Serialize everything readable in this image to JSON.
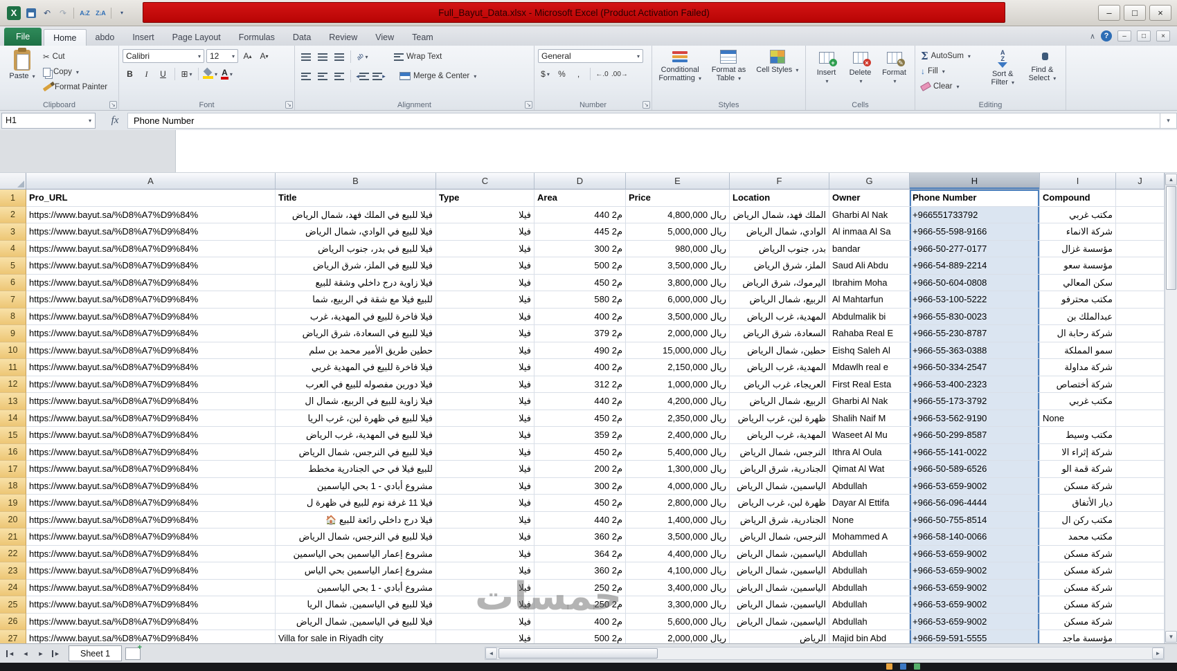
{
  "window": {
    "title": "Full_Bayut_Data.xlsx  -  Microsoft Excel (Product Activation Failed)",
    "accent_red": "#c00000"
  },
  "ribbon": {
    "tabs": [
      "File",
      "Home",
      "abdo",
      "Insert",
      "Page Layout",
      "Formulas",
      "Data",
      "Review",
      "View",
      "Team"
    ],
    "clipboard": {
      "label": "Clipboard",
      "paste": "Paste",
      "cut": "Cut",
      "copy": "Copy",
      "format_painter": "Format Painter"
    },
    "font": {
      "label": "Font",
      "family": "Calibri",
      "size": "12",
      "bold": "B",
      "italic": "I",
      "underline": "U"
    },
    "alignment": {
      "label": "Alignment",
      "wrap": "Wrap Text",
      "merge": "Merge & Center"
    },
    "number": {
      "label": "Number",
      "format": "General",
      "currency": "$",
      "percent": "%",
      "comma": ",",
      "inc_decimal": "←.0",
      "dec_decimal": ".00→"
    },
    "styles": {
      "label": "Styles",
      "conditional": "Conditional Formatting",
      "as_table": "Format as Table",
      "cell_styles": "Cell Styles"
    },
    "cells": {
      "label": "Cells",
      "insert": "Insert",
      "delete": "Delete",
      "format": "Format"
    },
    "editing": {
      "label": "Editing",
      "autosum": "AutoSum",
      "fill": "Fill",
      "clear": "Clear",
      "sort_filter": "Sort & Filter",
      "find_select": "Find & Select"
    }
  },
  "formula_bar": {
    "name_box": "H1",
    "function_label": "fx",
    "value": "Phone Number"
  },
  "grid": {
    "column_letters": [
      "A",
      "B",
      "C",
      "D",
      "E",
      "F",
      "G",
      "H",
      "I",
      "J"
    ],
    "selected_column": "H",
    "active_cell": "H1",
    "header_cells": [
      "Pro_URL",
      "Title",
      "Type",
      "Area",
      "Price",
      "Location",
      "Owner",
      "Phone Number",
      "Compound",
      ""
    ],
    "rows": [
      {
        "n": "2",
        "url": "https://www.bayut.sa/%D8%A7%D9%84%",
        "title": "فيلا للبيع في الملك فهد، شمال الرياض",
        "type": "فيلا",
        "area": "440 م2",
        "price": "4,800,000 ريال",
        "location": "الملك فهد، شمال الرياض",
        "owner": "Gharbi Al Nak",
        "phone": "+966551733792",
        "compound": "مكتب غربي"
      },
      {
        "n": "3",
        "url": "https://www.bayut.sa/%D8%A7%D9%84%",
        "title": "فيلا للبيع في الوادي، شمال الرياض",
        "type": "فيلا",
        "area": "445 م2",
        "price": "5,000,000 ريال",
        "location": "الوادي، شمال الرياض",
        "owner": "Al inmaa Al Sa",
        "phone": "+966-55-598-9166",
        "compound": "شركة الانماء"
      },
      {
        "n": "4",
        "url": "https://www.bayut.sa/%D8%A7%D9%84%",
        "title": "فيلا للبيع في بدر، جنوب الرياض",
        "type": "فيلا",
        "area": "300 م2",
        "price": "980,000 ريال",
        "location": "بدر، جنوب الرياض",
        "owner": "bandar",
        "phone": "+966-50-277-0177",
        "compound": "مؤسسة غزال"
      },
      {
        "n": "5",
        "url": "https://www.bayut.sa/%D8%A7%D9%84%",
        "title": "فيلا للبيع في الملز، شرق الرياض",
        "type": "فيلا",
        "area": "500 م2",
        "price": "3,500,000 ريال",
        "location": "الملز، شرق الرياض",
        "owner": "Saud Ali Abdu",
        "phone": "+966-54-889-2214",
        "compound": "مؤسسة سعو"
      },
      {
        "n": "6",
        "url": "https://www.bayut.sa/%D8%A7%D9%84%",
        "title": "فيلا زاوية درج داخلي وشقة للبيع",
        "type": "فيلا",
        "area": "450 م2",
        "price": "3,800,000 ريال",
        "location": "اليرموك، شرق الرياض",
        "owner": "Ibrahim Moha",
        "phone": "+966-50-604-0808",
        "compound": "سكن المعالي"
      },
      {
        "n": "7",
        "url": "https://www.bayut.sa/%D8%A7%D9%84%",
        "title": "للبيع فيلا مع شقة في الربيع، شما",
        "type": "فيلا",
        "area": "580 م2",
        "price": "6,000,000 ريال",
        "location": "الربيع، شمال الرياض",
        "owner": "Al Mahtarfun",
        "phone": "+966-53-100-5222",
        "compound": "مكتب محترفو"
      },
      {
        "n": "8",
        "url": "https://www.bayut.sa/%D8%A7%D9%84%",
        "title": "فيلا فاخرة للبيع في المهدية، غرب",
        "type": "فيلا",
        "area": "400 م2",
        "price": "3,500,000 ريال",
        "location": "المهدية، غرب الرياض",
        "owner": "Abdulmalik bi",
        "phone": "+966-55-830-0023",
        "compound": "عبدالملك بن"
      },
      {
        "n": "9",
        "url": "https://www.bayut.sa/%D8%A7%D9%84%",
        "title": "فيلا للبيع في السعادة، شرق الرياض",
        "type": "فيلا",
        "area": "379 م2",
        "price": "2,000,000 ريال",
        "location": "السعادة، شرق الرياض",
        "owner": "Rahaba Real E",
        "phone": "+966-55-230-8787",
        "compound": "شركة رحابة ال"
      },
      {
        "n": "10",
        "url": "https://www.bayut.sa/%D8%A7%D9%84%",
        "title": "حطين طريق الأمير محمد بن سلم",
        "type": "فيلا",
        "area": "490 م2",
        "price": "15,000,000 ريال",
        "location": "حطين، شمال الرياض",
        "owner": "Eishq Saleh Al",
        "phone": "+966-55-363-0388",
        "compound": "سمو المملكة"
      },
      {
        "n": "11",
        "url": "https://www.bayut.sa/%D8%A7%D9%84%",
        "title": "فيلا فاخرة للبيع في المهدية غربي",
        "type": "فيلا",
        "area": "400 م2",
        "price": "2,150,000 ريال",
        "location": "المهدية، غرب الرياض",
        "owner": "Mdawlh real e",
        "phone": "+966-50-334-2547",
        "compound": "شركة مداولة"
      },
      {
        "n": "12",
        "url": "https://www.bayut.sa/%D8%A7%D9%84%",
        "title": "فيلا دورين مفصوله للبيع في العرب",
        "type": "فيلا",
        "area": "312 م2",
        "price": "1,000,000 ريال",
        "location": "العريجاء، غرب الرياض",
        "owner": "First Real Esta",
        "phone": "+966-53-400-2323",
        "compound": "شركة أختصاص"
      },
      {
        "n": "13",
        "url": "https://www.bayut.sa/%D8%A7%D9%84%",
        "title": "فيلا زاوية للبيع في الربيع، شمال ال",
        "type": "فيلا",
        "area": "440 م2",
        "price": "4,200,000 ريال",
        "location": "الربيع، شمال الرياض",
        "owner": "Gharbi Al Nak",
        "phone": "+966-55-173-3792",
        "compound": "مكتب غربي"
      },
      {
        "n": "14",
        "url": "https://www.bayut.sa/%D8%A7%D9%84%",
        "title": "فيلا للبيع في ظهرة لبن، غرب الريا",
        "type": "فيلا",
        "area": "450 م2",
        "price": "2,350,000 ريال",
        "location": "ظهرة لبن، غرب الرياض",
        "owner": "Shalih Naif M",
        "phone": "+966-53-562-9190",
        "compound": "None"
      },
      {
        "n": "15",
        "url": "https://www.bayut.sa/%D8%A7%D9%84%",
        "title": "فيلا للبيع في المهدية، غرب الرياض",
        "type": "فيلا",
        "area": "359 م2",
        "price": "2,400,000 ريال",
        "location": "المهدية، غرب الرياض",
        "owner": "Waseet Al Mu",
        "phone": "+966-50-299-8587",
        "compound": "مكتب وسيط"
      },
      {
        "n": "16",
        "url": "https://www.bayut.sa/%D8%A7%D9%84%",
        "title": "فيلا للبيع في النرجس، شمال الرياض",
        "type": "فيلا",
        "area": "450 م2",
        "price": "5,400,000 ريال",
        "location": "النرجس، شمال الرياض",
        "owner": "Ithra Al Oula",
        "phone": "+966-55-141-0022",
        "compound": "شركة إثراء الا"
      },
      {
        "n": "17",
        "url": "https://www.bayut.sa/%D8%A7%D9%84%",
        "title": "للبيع فيلا في حي الجنادرية مخطط",
        "type": "فيلا",
        "area": "200 م2",
        "price": "1,300,000 ريال",
        "location": "الجنادرية، شرق الرياض",
        "owner": "Qimat Al Wat",
        "phone": "+966-50-589-6526",
        "compound": "شركة قمة الو"
      },
      {
        "n": "18",
        "url": "https://www.bayut.sa/%D8%A7%D9%84%",
        "title": "مشروع أبادي - 1 بحي الياسمين",
        "type": "فيلا",
        "area": "300 م2",
        "price": "4,000,000 ريال",
        "location": "الياسمين، شمال الرياض",
        "owner": "Abdullah",
        "phone": "+966-53-659-9002",
        "compound": "شركة مسكن"
      },
      {
        "n": "19",
        "url": "https://www.bayut.sa/%D8%A7%D9%84%",
        "title": "فيلا 11 غرفة نوم للبيع في ظهرة ل",
        "type": "فيلا",
        "area": "450 م2",
        "price": "2,800,000 ريال",
        "location": "ظهرة لبن، غرب الرياض",
        "owner": "Dayar Al Ettifa",
        "phone": "+966-56-096-4444",
        "compound": "ديار الأتفاق"
      },
      {
        "n": "20",
        "url": "https://www.bayut.sa/%D8%A7%D9%84%",
        "title": "فيلا درج داخلي رائعة للبيع 🏠",
        "type": "فيلا",
        "area": "440 م2",
        "price": "1,400,000 ريال",
        "location": "الجنادرية، شرق الرياض",
        "owner": "None",
        "phone": "+966-50-755-8514",
        "compound": "مكتب ركن ال"
      },
      {
        "n": "21",
        "url": "https://www.bayut.sa/%D8%A7%D9%84%",
        "title": "فيلا للبيع في النرجس، شمال الرياض",
        "type": "فيلا",
        "area": "360 م2",
        "price": "3,500,000 ريال",
        "location": "النرجس، شمال الرياض",
        "owner": "Mohammed A",
        "phone": "+966-58-140-0066",
        "compound": "مكتب محمد"
      },
      {
        "n": "22",
        "url": "https://www.bayut.sa/%D8%A7%D9%84%",
        "title": "مشروع إعمار الياسمين بحي الياسمين",
        "type": "فيلا",
        "area": "364 م2",
        "price": "4,400,000 ريال",
        "location": "الياسمين، شمال الرياض",
        "owner": "Abdullah",
        "phone": "+966-53-659-9002",
        "compound": "شركة مسكن"
      },
      {
        "n": "23",
        "url": "https://www.bayut.sa/%D8%A7%D9%84%",
        "title": "مشروع إعمار الياسمين بحي الياس",
        "type": "فيلا",
        "area": "360 م2",
        "price": "4,100,000 ريال",
        "location": "الياسمين، شمال الرياض",
        "owner": "Abdullah",
        "phone": "+966-53-659-9002",
        "compound": "شركة مسكن"
      },
      {
        "n": "24",
        "url": "https://www.bayut.sa/%D8%A7%D9%84%",
        "title": "مشروع أبادي - 1 بحي الياسمين",
        "type": "فيلا",
        "area": "250 م2",
        "price": "3,400,000 ريال",
        "location": "الياسمين، شمال الرياض",
        "owner": "Abdullah",
        "phone": "+966-53-659-9002",
        "compound": "شركة مسكن"
      },
      {
        "n": "25",
        "url": "https://www.bayut.sa/%D8%A7%D9%84%",
        "title": "فيلا للبيع في الياسمين, شمال الريا",
        "type": "فيلا",
        "area": "250 م2",
        "price": "3,300,000 ريال",
        "location": "الياسمين، شمال الرياض",
        "owner": "Abdullah",
        "phone": "+966-53-659-9002",
        "compound": "شركة مسكن"
      },
      {
        "n": "26",
        "url": "https://www.bayut.sa/%D8%A7%D9%84%",
        "title": "فيلا للبيع في الياسمين, شمال الرياض",
        "type": "فيلا",
        "area": "400 م2",
        "price": "5,600,000 ريال",
        "location": "الياسمين، شمال الرياض",
        "owner": "Abdullah",
        "phone": "+966-53-659-9002",
        "compound": "شركة مسكن"
      },
      {
        "n": "27",
        "url": "https://www.bayut.sa/%D8%A7%D9%84%",
        "title": "Villa for sale in Riyadh city",
        "type": "فيلا",
        "area": "500 م2",
        "price": "2,000,000 ريال",
        "location": "الرياض",
        "owner": "Majid bin Abd",
        "phone": "+966-59-591-5555",
        "compound": "مؤسسة ماجد"
      }
    ]
  },
  "sheet_bar": {
    "tab": "Sheet 1"
  },
  "watermark": "خمسات"
}
